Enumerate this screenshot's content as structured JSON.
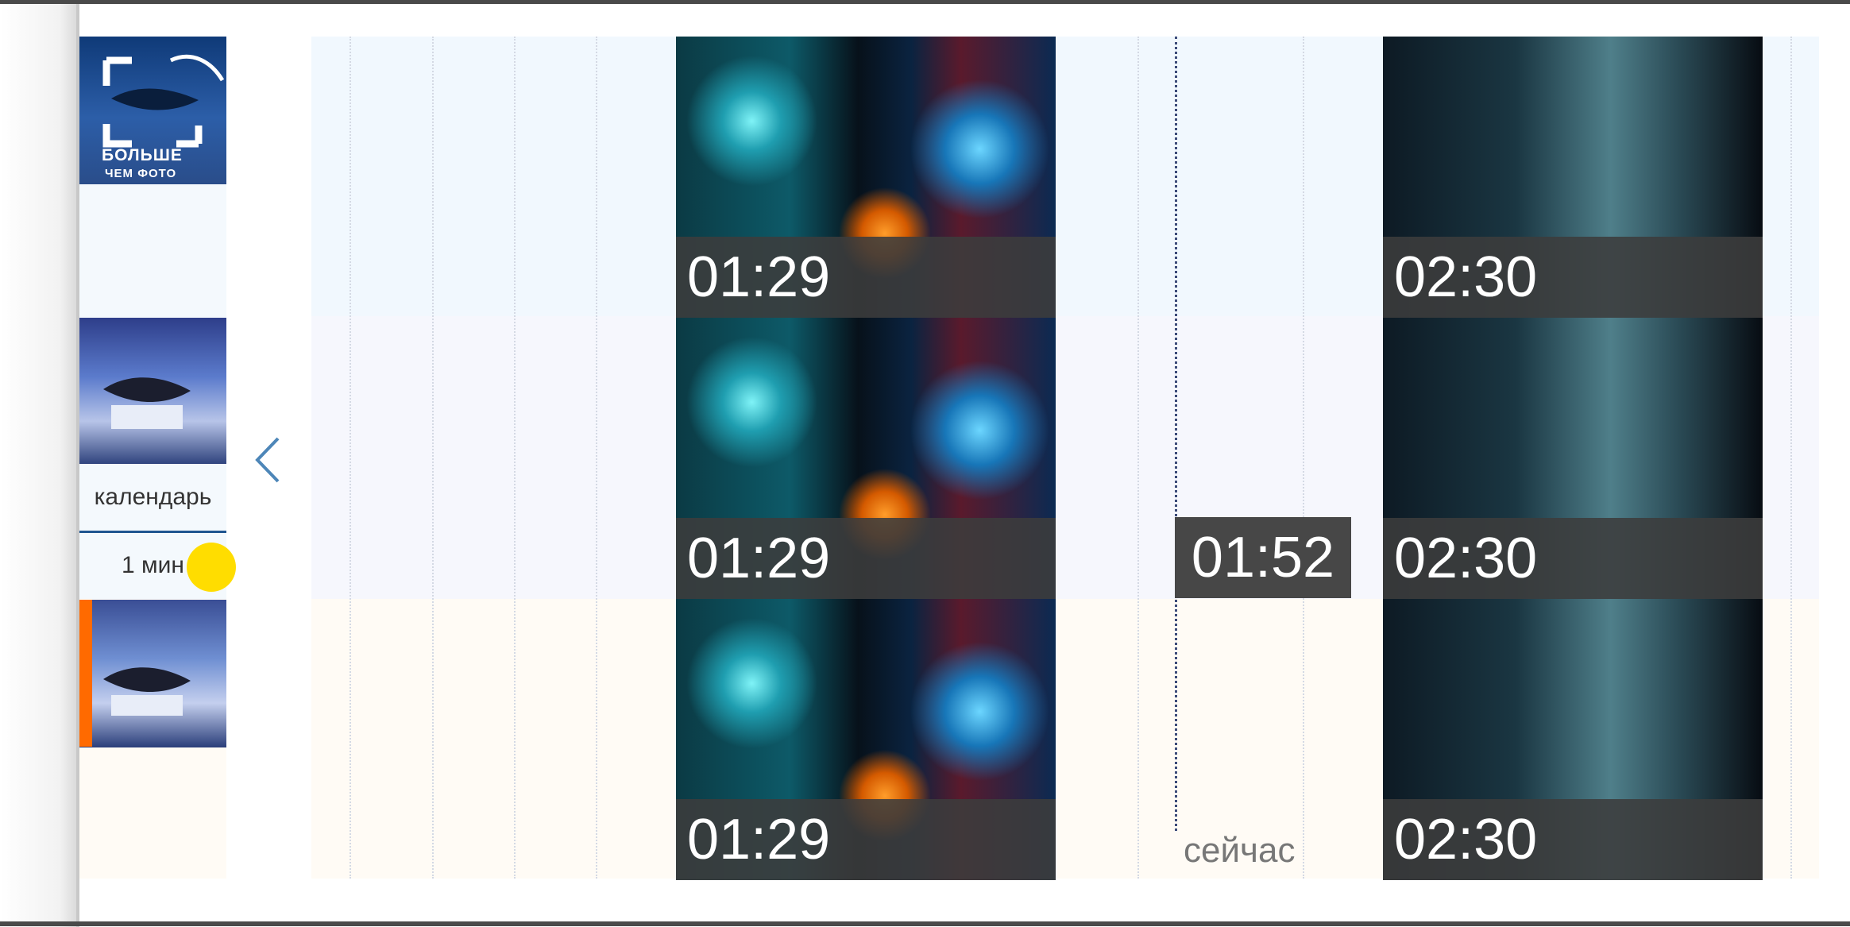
{
  "sidebar": {
    "logo": {
      "line1": "БОЛЬШЕ",
      "line2": "ЧЕМ ФОТО"
    },
    "calendar_label": "календарь",
    "zoom_label": "1 мин"
  },
  "timeline": {
    "rows": [
      {
        "tiles": [
          {
            "time": "01:29"
          },
          {
            "time": "02:30"
          }
        ]
      },
      {
        "tiles": [
          {
            "time": "01:29"
          },
          {
            "time": "02:30"
          }
        ]
      },
      {
        "tiles": [
          {
            "time": "01:29"
          },
          {
            "time": "02:30"
          }
        ]
      }
    ],
    "now_time": "01:52",
    "now_label": "сейчас"
  },
  "colors": {
    "accent_orange": "#ff6a00",
    "cursor_yellow": "#ffdd00",
    "now_line": "#3b4a78"
  },
  "icons": {
    "nav_prev": "chevron-left-icon"
  }
}
